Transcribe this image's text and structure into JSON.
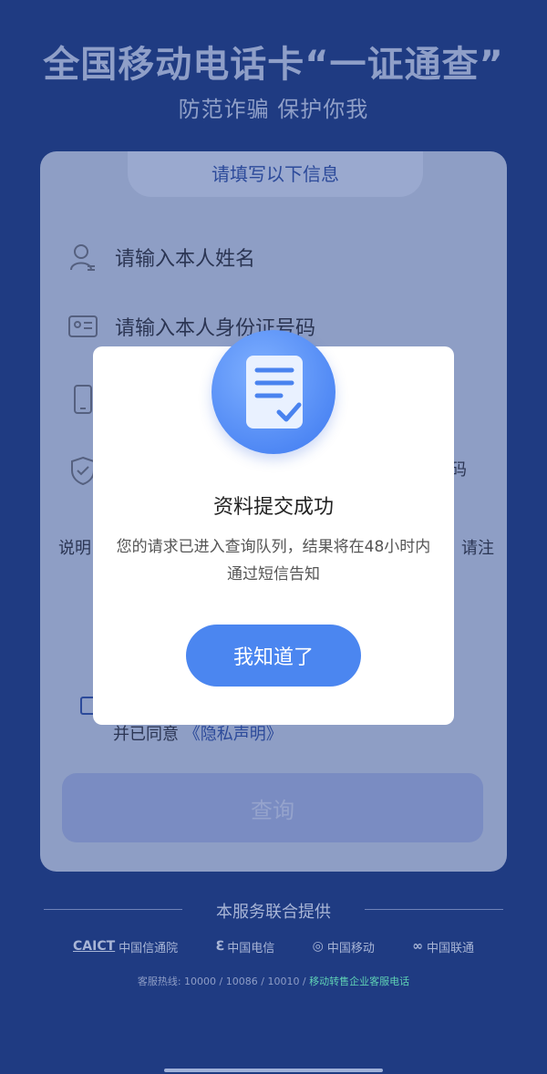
{
  "header": {
    "title": "全国移动电话卡“一证通查”",
    "subtitle": "防范诈骗 保护你我"
  },
  "form": {
    "tab_label": "请填写以下信息",
    "name_placeholder": "请输入本人姓名",
    "id_placeholder": "请输入本人身份证号码",
    "partial_right_1": "码",
    "partial_left": "说明",
    "partial_right_2": "请注",
    "agree_text": "并已同意",
    "privacy_link": "《隐私声明》",
    "query_button": "查询"
  },
  "footer": {
    "title": "本服务联合提供",
    "logos": {
      "caict_abbr": "CAICT",
      "caict_name": "中国信通院",
      "telecom": "中国电信",
      "mobile": "中国移动",
      "unicom": "中国联通"
    },
    "hotline_prefix": "客服热线: 10000 / 10086 / 10010 / ",
    "hotline_link": "移动转售企业客服电话"
  },
  "modal": {
    "title": "资料提交成功",
    "message": "您的请求已进入查询队列，结果将在48小时内通过短信告知",
    "button": "我知道了"
  }
}
